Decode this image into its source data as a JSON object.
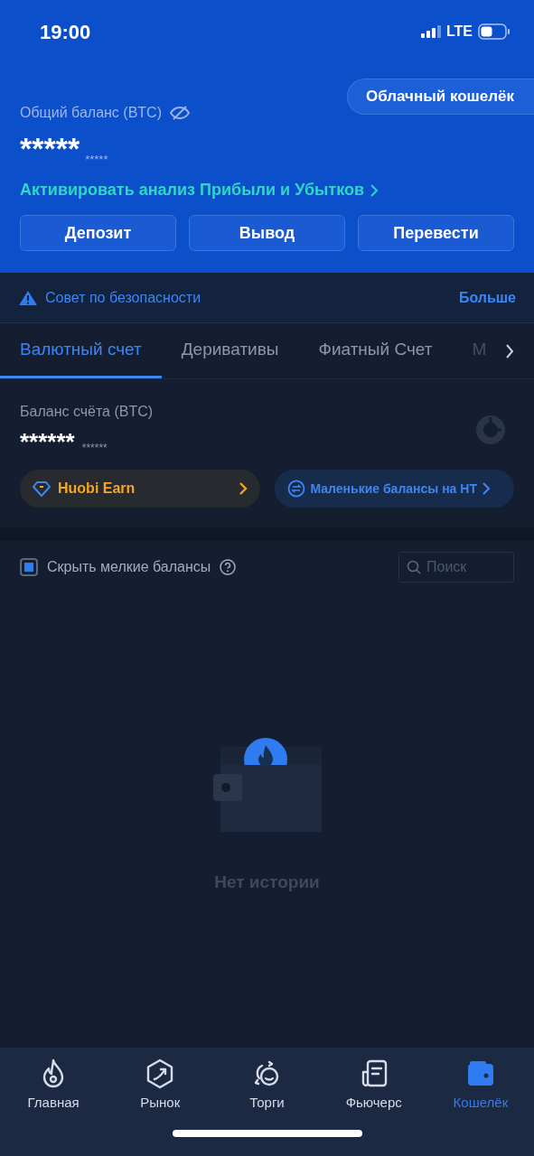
{
  "status_bar": {
    "time": "19:00",
    "network": "LTE"
  },
  "header": {
    "cloud_wallet_button": "Облачный кошелёк",
    "total_label": "Общий баланс (BTC)",
    "hidden_balance": "*****",
    "hidden_balance_small": "*****",
    "pnl_link": "Активировать анализ Прибыли и Убытков",
    "actions": [
      "Депозит",
      "Вывод",
      "Перевести"
    ]
  },
  "security_tip": {
    "text": "Совет по безопасности",
    "more": "Больше"
  },
  "tabs": [
    {
      "label": "Валютный счет",
      "selected": true
    },
    {
      "label": "Деривативы",
      "selected": false
    },
    {
      "label": "Фиатный Счет",
      "selected": false
    },
    {
      "label": "М",
      "selected": false
    }
  ],
  "account": {
    "label": "Баланс счёта (BTC)",
    "balance": "******",
    "balance_small": "******",
    "earn_button": "Huobi Earn",
    "small_balances_button": "Маленькие балансы на HT"
  },
  "filter": {
    "label": "Скрыть мелкие балансы",
    "checked": true,
    "search_placeholder": "Поиск"
  },
  "empty": {
    "text": "Нет истории"
  },
  "nav": [
    {
      "label": "Главная",
      "selected": false
    },
    {
      "label": "Рынок",
      "selected": false
    },
    {
      "label": "Торги",
      "selected": false
    },
    {
      "label": "Фьючерс",
      "selected": false
    },
    {
      "label": "Кошелёк",
      "selected": true
    }
  ]
}
